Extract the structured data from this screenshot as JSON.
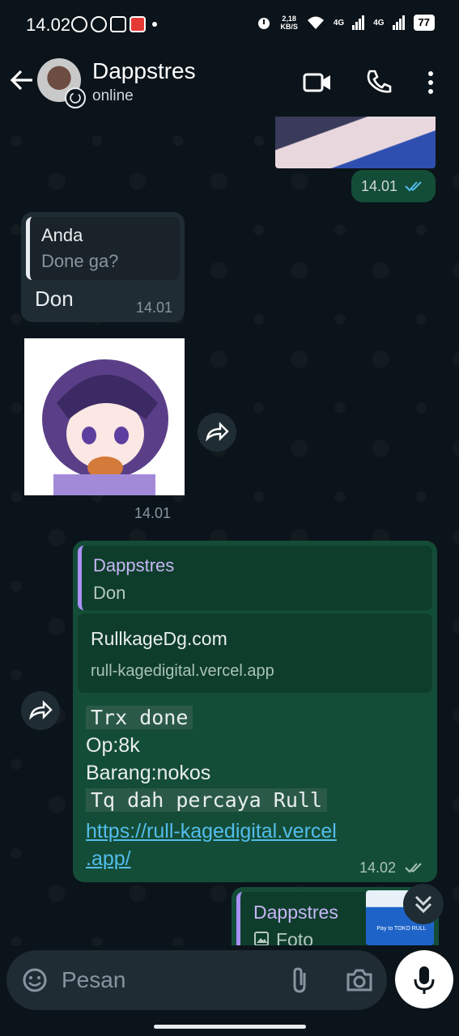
{
  "status_bar": {
    "time": "14.02",
    "net_speed_value": "2,18",
    "net_speed_unit": "KB/S",
    "signal_1": "4G",
    "signal_2": "4G",
    "battery": "77"
  },
  "header": {
    "contact_name": "Dappstres",
    "contact_status": "online"
  },
  "messages": [
    {
      "id": "m1",
      "direction": "out",
      "type": "image",
      "time": "14.01",
      "ticks": "read"
    },
    {
      "id": "m2",
      "direction": "in",
      "type": "text",
      "quote_author": "Anda",
      "quote_text": "Done ga?",
      "text": "Don",
      "time": "14.01"
    },
    {
      "id": "m3",
      "direction": "in",
      "type": "sticker",
      "time": "14.01"
    },
    {
      "id": "m4",
      "direction": "out",
      "type": "text",
      "quote_author": "Dappstres",
      "quote_text": "Don",
      "link_title": "RullkageDg.com",
      "link_domain": "rull-kagedigital.vercel.app",
      "line1": "Trx done",
      "line2": "Op:8k",
      "line3": "Barang:nokos",
      "line4": "Tq dah percaya Rull",
      "url_line1": "https://rull-kagedigital.vercel",
      "url_line2": ".app/",
      "time": "14.02",
      "ticks": "delivered"
    },
    {
      "id": "m5",
      "direction": "out",
      "type": "reply-photo",
      "quote_author": "Dappstres",
      "quote_text": "Foto",
      "thumb_text": "Pay to TOKO RULL"
    }
  ],
  "composer": {
    "placeholder": "Pesan"
  },
  "colors": {
    "background": "#0b141a",
    "incoming_bubble": "#1f2c34",
    "outgoing_bubble": "#144d37",
    "link": "#53bdeb",
    "read_tick": "#53bdeb",
    "quote_bar_purple": "#a991f7"
  },
  "icons": [
    "back-arrow-icon",
    "video-call-icon",
    "phone-icon",
    "more-vert-icon",
    "forward-icon",
    "emoji-icon",
    "attach-icon",
    "camera-icon",
    "mic-icon",
    "chevron-double-down-icon"
  ]
}
